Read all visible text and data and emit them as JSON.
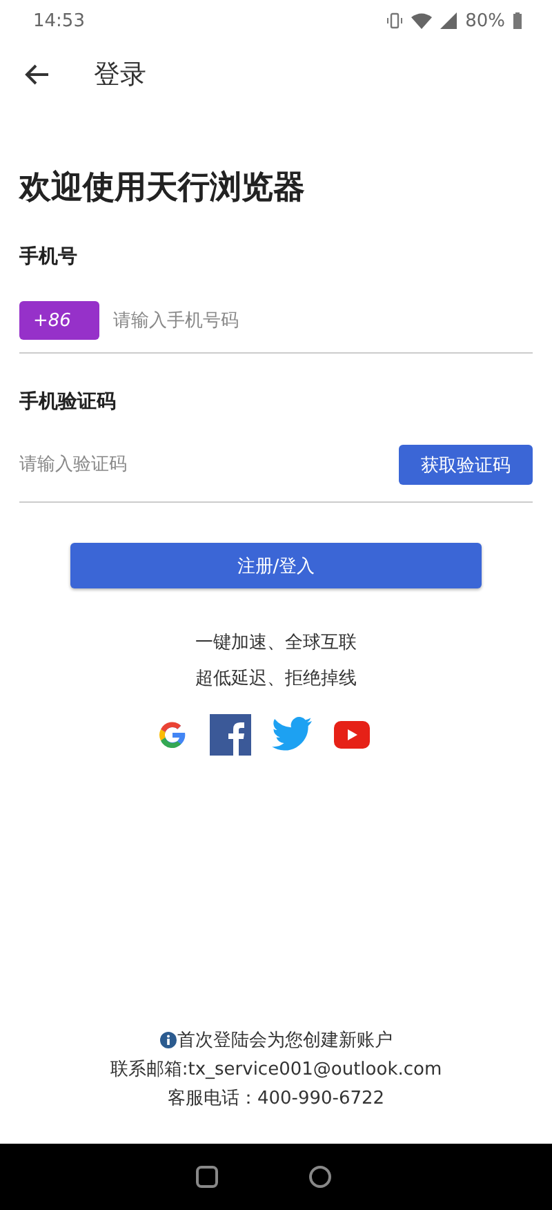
{
  "status_bar": {
    "time": "14:53",
    "battery": "80%"
  },
  "app_bar": {
    "title": "登录"
  },
  "heading": "欢迎使用天行浏览器",
  "phone": {
    "label": "手机号",
    "country_code": "+86",
    "placeholder": "请输入手机号码"
  },
  "code": {
    "label": "手机验证码",
    "placeholder": "请输入验证码",
    "button": "获取验证码"
  },
  "submit": "注册/登入",
  "slogans": [
    "一键加速、全球互联",
    "超低延迟、拒绝掉线"
  ],
  "social": [
    {
      "kind": "google"
    },
    {
      "kind": "facebook"
    },
    {
      "kind": "twitter"
    },
    {
      "kind": "youtube"
    }
  ],
  "footer": {
    "notice": "首次登陆会为您创建新账户",
    "email": "联系邮箱:tx_service001@outlook.com",
    "phone": "客服电话：400-990-6722"
  }
}
